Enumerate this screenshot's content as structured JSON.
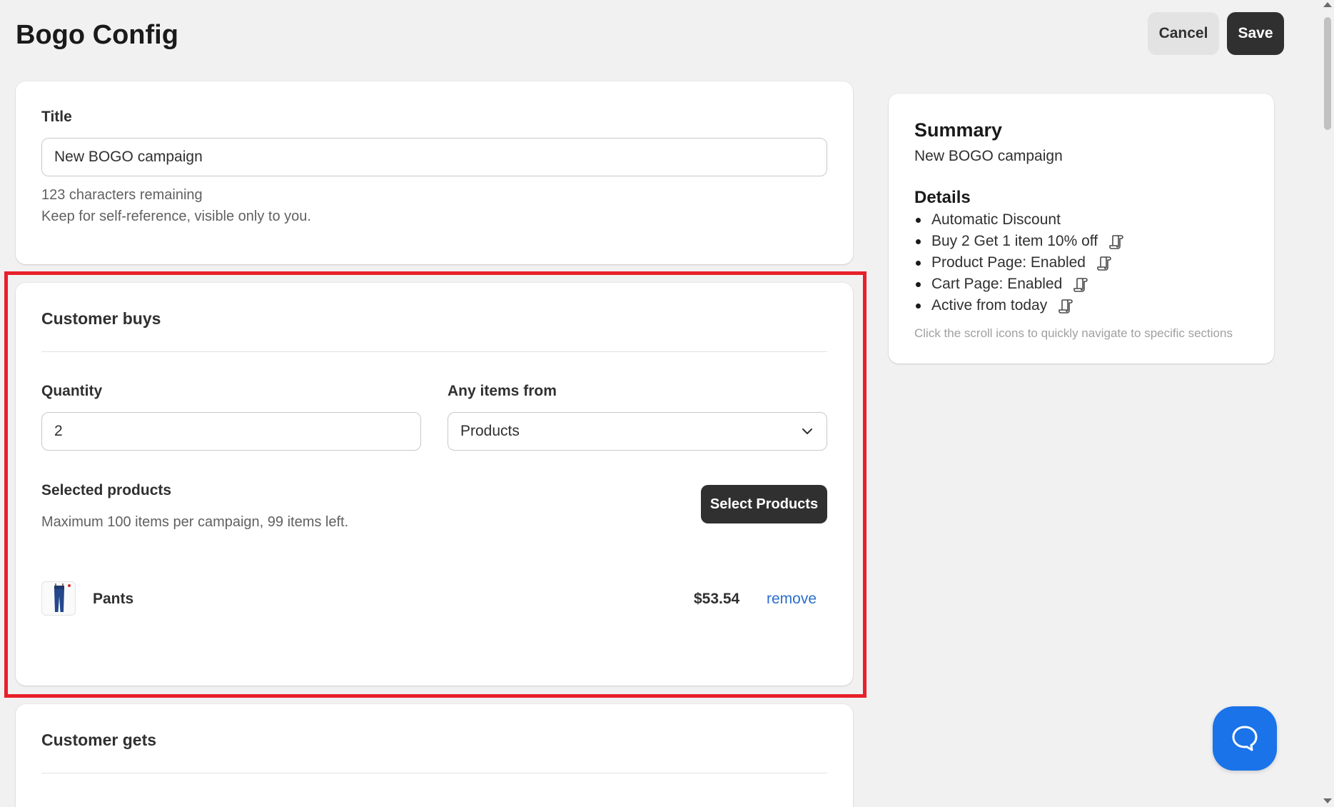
{
  "header": {
    "title": "Bogo Config",
    "cancel_label": "Cancel",
    "save_label": "Save"
  },
  "title_card": {
    "label": "Title",
    "value": "New BOGO campaign",
    "chars_remaining": "123 characters remaining",
    "help": "Keep for self-reference, visible only to you."
  },
  "customer_buys": {
    "heading": "Customer buys",
    "quantity_label": "Quantity",
    "quantity_value": "2",
    "items_from_label": "Any items from",
    "items_from_value": "Products",
    "selected_label": "Selected products",
    "selected_help": "Maximum 100 items per campaign, 99 items left.",
    "select_button": "Select Products",
    "products": [
      {
        "name": "Pants",
        "price": "$53.54",
        "remove_label": "remove"
      }
    ]
  },
  "customer_gets": {
    "heading": "Customer gets"
  },
  "summary": {
    "heading": "Summary",
    "campaign_name": "New BOGO campaign",
    "details_heading": "Details",
    "details": [
      {
        "text": "Automatic Discount",
        "icon": ""
      },
      {
        "text": "Buy 2 Get 1 item 10% off",
        "icon": "scroll-icon"
      },
      {
        "text": "Product Page: Enabled",
        "icon": "scroll-icon"
      },
      {
        "text": "Cart Page: Enabled",
        "icon": "scroll-icon"
      },
      {
        "text": "Active from today",
        "icon": "scroll-icon"
      }
    ],
    "hint": "Click the scroll icons to quickly navigate to specific sections"
  },
  "colors": {
    "highlight": "#e8202a",
    "primary_button": "#303030",
    "link": "#2c6ecb",
    "chat_button": "#1a73e8"
  }
}
